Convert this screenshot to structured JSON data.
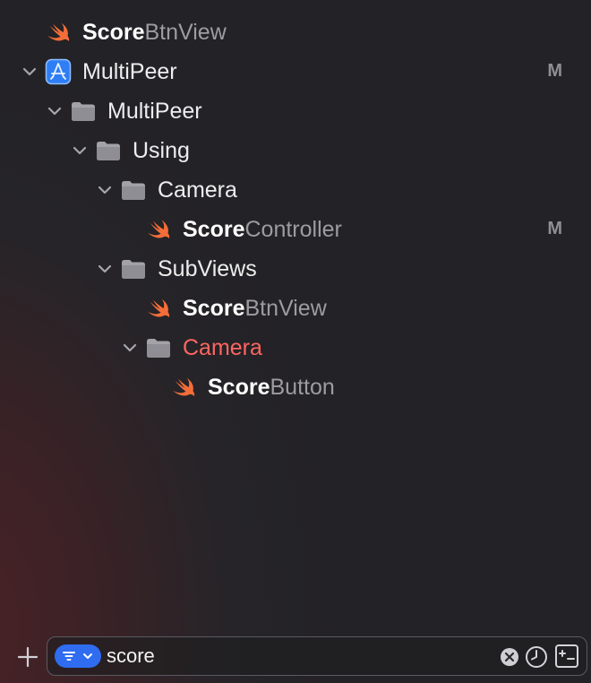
{
  "tree": [
    {
      "id": "r0",
      "match": "Score",
      "rest": "BtnView",
      "kind": "swift",
      "badge": ""
    },
    {
      "id": "r1",
      "text": "MultiPeer",
      "kind": "project",
      "badge": "M"
    },
    {
      "id": "r2",
      "text": "MultiPeer",
      "kind": "folder"
    },
    {
      "id": "r3",
      "text": "Using",
      "kind": "folder"
    },
    {
      "id": "r4",
      "text": "Camera",
      "kind": "folder"
    },
    {
      "id": "r5",
      "match": "Score",
      "rest": "Controller",
      "kind": "swift",
      "badge": "M"
    },
    {
      "id": "r6",
      "text": "SubViews",
      "kind": "folder"
    },
    {
      "id": "r7",
      "match": "Score",
      "rest": "BtnView",
      "kind": "swift"
    },
    {
      "id": "r8",
      "text": "Camera",
      "kind": "folder",
      "status": "missing"
    },
    {
      "id": "r9",
      "match": "Score",
      "rest": "Button",
      "kind": "swift"
    }
  ],
  "filter": {
    "value": "score",
    "placeholder": "Filter"
  },
  "colors": {
    "accent": "#2f6cf0",
    "swift": "#f05138",
    "folder": "#9a9aa0",
    "missing": "#ff6661",
    "badge": "#8f8f94"
  }
}
